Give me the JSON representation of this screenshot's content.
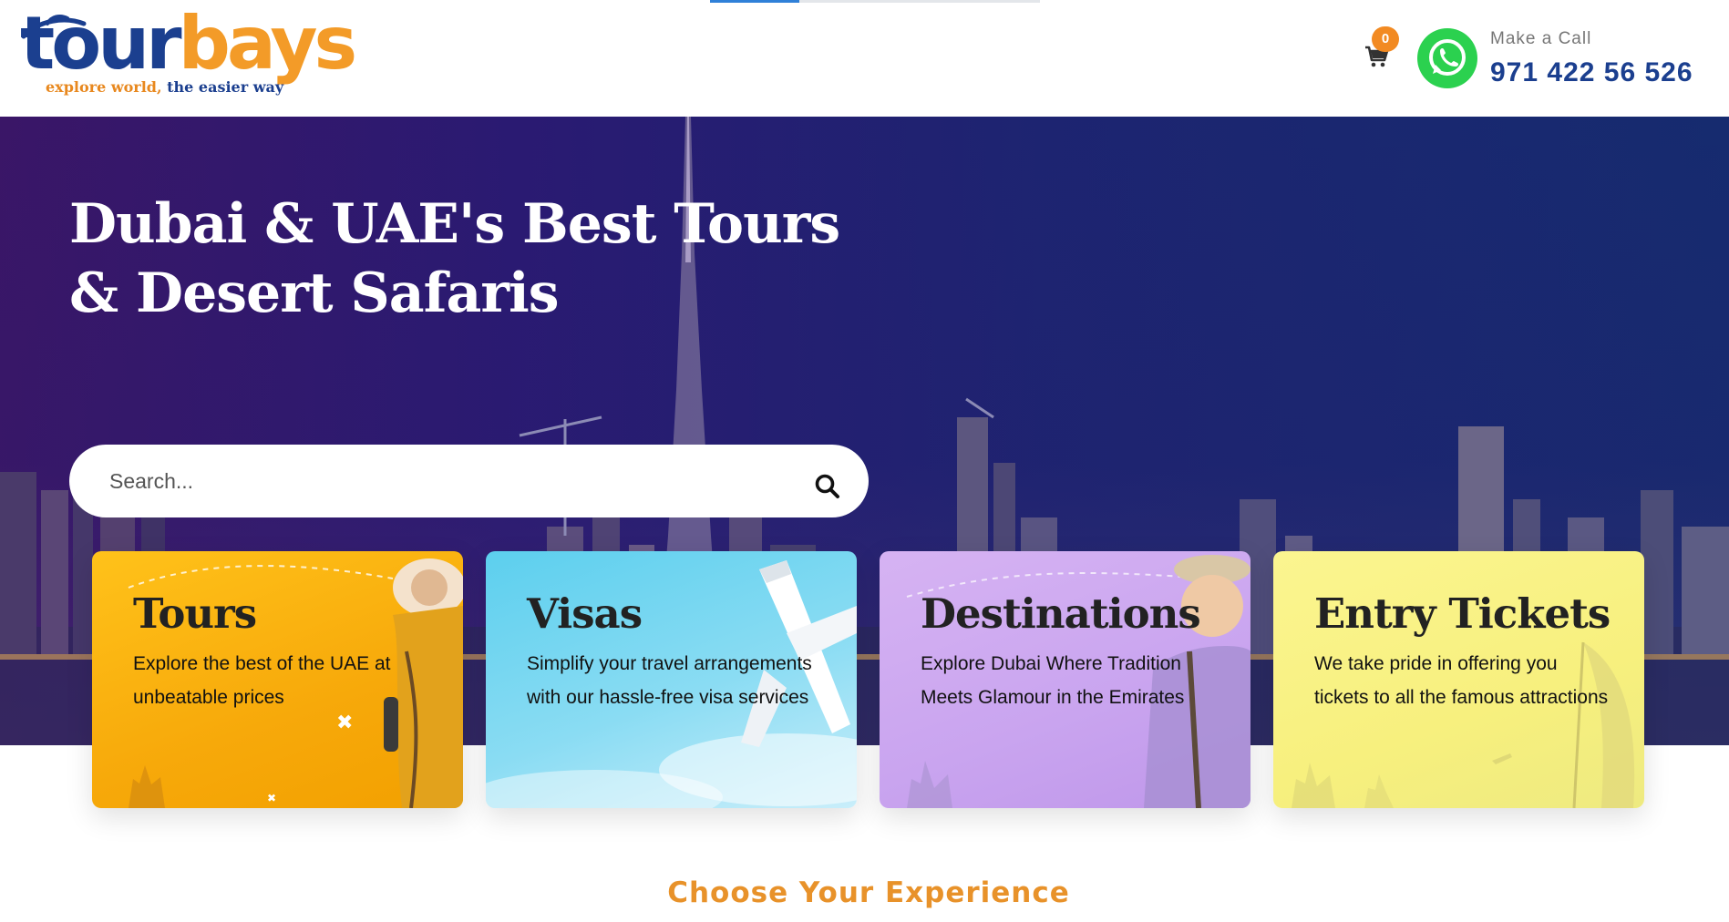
{
  "header": {
    "logo": {
      "brand_part1": "tour",
      "brand_part2": "bays",
      "tagline_part1": "explore world,",
      "tagline_part2": "the easier way"
    },
    "page_progress": 0.27,
    "cart": {
      "icon": "shopping-cart-icon",
      "count": "0"
    },
    "call": {
      "icon": "whatsapp-icon",
      "label": "Make a Call",
      "number": "971 422 56 526"
    }
  },
  "hero": {
    "title": "Dubai & UAE's Best Tours & Desert Safaris",
    "search": {
      "placeholder": "Search...",
      "value": "",
      "icon": "search-icon"
    }
  },
  "categories": [
    {
      "title": "Tours",
      "description": "Explore the best of the UAE at unbeatable prices"
    },
    {
      "title": "Visas",
      "description": "Simplify your travel arrangements with our hassle-free visa services"
    },
    {
      "title": "Destinations",
      "description": "Explore Dubai Where Tradition Meets Glamour in the Emirates"
    },
    {
      "title": "Entry Tickets",
      "description": "We take pride in offering you tickets to all the famous attractions"
    }
  ],
  "section": {
    "heading": "Choose Your Experience"
  },
  "colors": {
    "brand_blue": "#1b3f8f",
    "brand_orange": "#f39b28",
    "whatsapp_green": "#2bd14f",
    "tours_card": "#f7a90a",
    "visas_card": "#8adcf3",
    "destinations_card": "#c9a4ef",
    "tickets_card": "#f7f07e"
  }
}
